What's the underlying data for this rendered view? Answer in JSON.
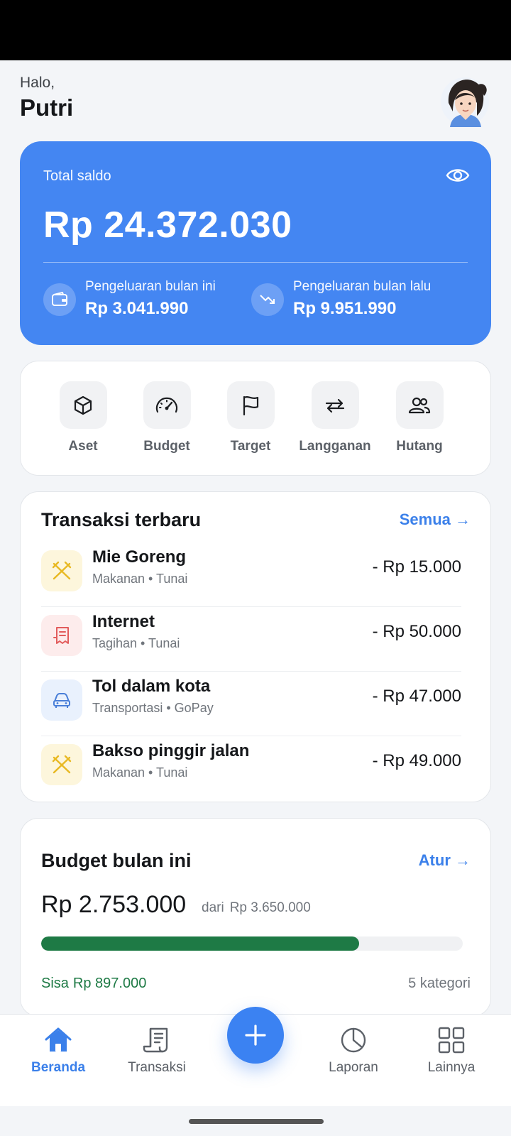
{
  "header": {
    "greeting": "Halo,",
    "name": "Putri"
  },
  "balance": {
    "label": "Total saldo",
    "amount": "Rp 24.372.030",
    "this_month": {
      "label": "Pengeluaran bulan ini",
      "value": "Rp 3.041.990"
    },
    "last_month": {
      "label": "Pengeluaran bulan lalu",
      "value": "Rp 9.951.990"
    }
  },
  "menu": {
    "items": [
      {
        "label": "Aset",
        "icon": "cube-icon"
      },
      {
        "label": "Budget",
        "icon": "gauge-icon"
      },
      {
        "label": "Target",
        "icon": "flag-icon"
      },
      {
        "label": "Langganan",
        "icon": "repeat-icon"
      },
      {
        "label": "Hutang",
        "icon": "users-icon"
      }
    ]
  },
  "transactions": {
    "title": "Transaksi terbaru",
    "link": "Semua →",
    "items": [
      {
        "name": "Mie Goreng",
        "meta": "Makanan • Tunai",
        "amount": "- Rp 15.000",
        "icon": "utensils-icon",
        "tint": "#fdf6dc",
        "color": "#e8b923"
      },
      {
        "name": "Internet",
        "meta": "Tagihan • Tunai",
        "amount": "- Rp 50.000",
        "icon": "receipt-icon",
        "tint": "#fdecec",
        "color": "#e25c5c"
      },
      {
        "name": "Tol dalam kota",
        "meta": "Transportasi • GoPay",
        "amount": "- Rp 47.000",
        "icon": "car-icon",
        "tint": "#e9f1fd",
        "color": "#4a7fd8"
      },
      {
        "name": "Bakso pinggir jalan",
        "meta": "Makanan • Tunai",
        "amount": "- Rp 49.000",
        "icon": "utensils-icon",
        "tint": "#fdf6dc",
        "color": "#e8b923"
      }
    ]
  },
  "budget": {
    "title": "Budget bulan ini",
    "link": "Atur →",
    "spent": "Rp 2.753.000",
    "of_label": "dari",
    "limit": "Rp 3.650.000",
    "progress": 0.754,
    "remaining_label": "Sisa",
    "remaining": "Rp 897.000",
    "categories": "5 kategori"
  },
  "nav": {
    "items": [
      {
        "label": "Beranda",
        "icon": "home-icon",
        "active": true
      },
      {
        "label": "Transaksi",
        "icon": "receipt-icon",
        "active": false
      },
      {
        "label": "Laporan",
        "icon": "pie-chart-icon",
        "active": false
      },
      {
        "label": "Lainnya",
        "icon": "grid-icon",
        "active": false
      }
    ],
    "fab_icon": "plus-icon"
  },
  "colors": {
    "primary": "#4486f2",
    "link": "#3b80ea",
    "success": "#1e7a45"
  }
}
